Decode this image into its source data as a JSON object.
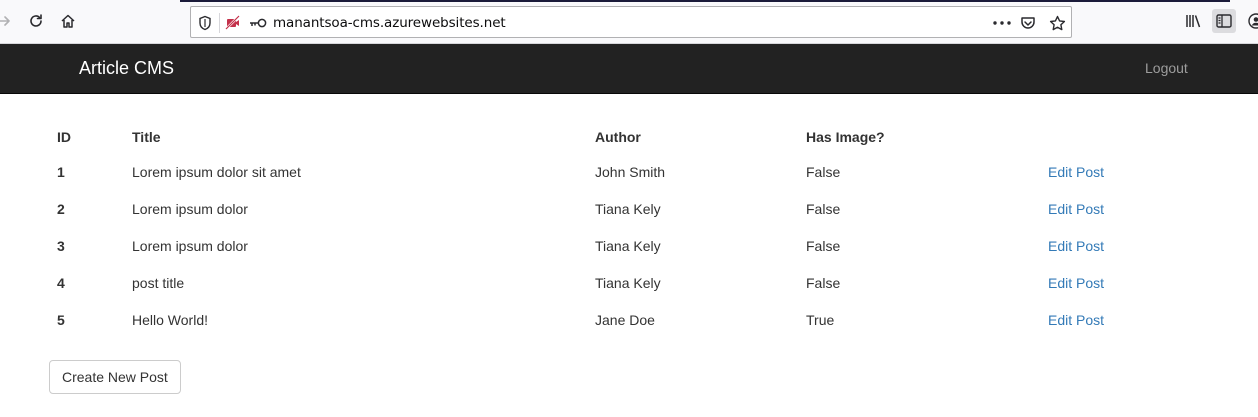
{
  "browser": {
    "url": "manantsoa-cms.azurewebsites.net",
    "icons": [
      "forward-icon",
      "reload-icon",
      "home-icon",
      "shield-icon",
      "no-camera-icon",
      "key-icon",
      "more-icon",
      "pocket-icon",
      "bookmark-star-icon",
      "library-icon",
      "sidebar-icon",
      "account-icon"
    ]
  },
  "navbar": {
    "brand": "Article CMS",
    "logout_label": "Logout",
    "background": "#222222"
  },
  "table": {
    "headers": {
      "id": "ID",
      "title": "Title",
      "author": "Author",
      "has_image": "Has Image?"
    },
    "rows": [
      {
        "id": "1",
        "title": "Lorem ipsum dolor sit amet",
        "author": "John Smith",
        "has_image": "False",
        "action": "Edit Post"
      },
      {
        "id": "2",
        "title": "Lorem ipsum dolor",
        "author": "Tiana Kely",
        "has_image": "False",
        "action": "Edit Post"
      },
      {
        "id": "3",
        "title": "Lorem ipsum dolor",
        "author": "Tiana Kely",
        "has_image": "False",
        "action": "Edit Post"
      },
      {
        "id": "4",
        "title": "post title",
        "author": "Tiana Kely",
        "has_image": "False",
        "action": "Edit Post"
      },
      {
        "id": "5",
        "title": "Hello World!",
        "author": "Jane Doe",
        "has_image": "True",
        "action": "Edit Post"
      }
    ]
  },
  "create_button_label": "Create New Post",
  "colors": {
    "link": "#337ab7",
    "text": "#333333"
  }
}
